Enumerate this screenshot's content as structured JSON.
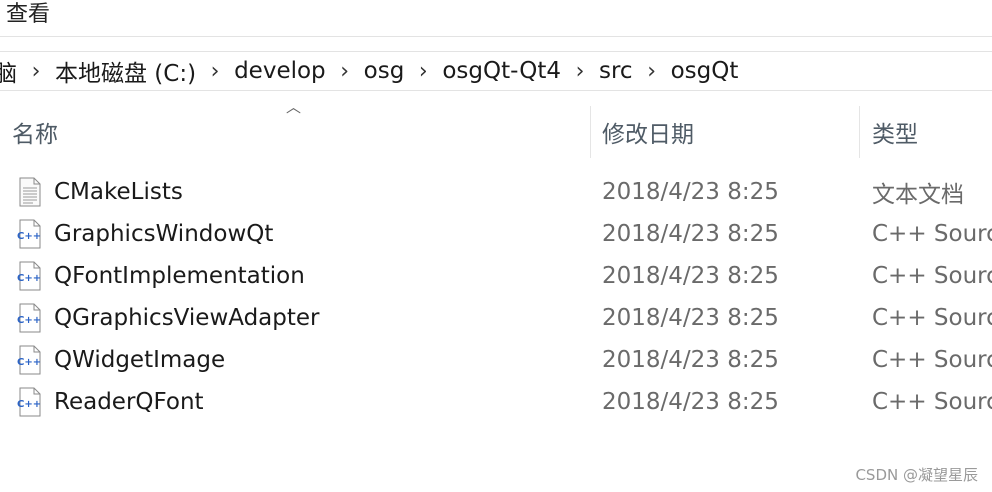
{
  "ribbon": {
    "view_tab": "查看"
  },
  "breadcrumb": [
    "脑",
    "本地磁盘 (C:)",
    "develop",
    "osg",
    "osgQt-Qt4",
    "src",
    "osgQt"
  ],
  "columns": {
    "name": "名称",
    "date": "修改日期",
    "type": "类型"
  },
  "files": [
    {
      "name": "CMakeLists",
      "date": "2018/4/23 8:25",
      "type": "文本文档",
      "icon": "text-file-icon"
    },
    {
      "name": "GraphicsWindowQt",
      "date": "2018/4/23 8:25",
      "type": "C++ Sourc",
      "icon": "cpp-file-icon"
    },
    {
      "name": "QFontImplementation",
      "date": "2018/4/23 8:25",
      "type": "C++ Sourc",
      "icon": "cpp-file-icon"
    },
    {
      "name": "QGraphicsViewAdapter",
      "date": "2018/4/23 8:25",
      "type": "C++ Sourc",
      "icon": "cpp-file-icon"
    },
    {
      "name": "QWidgetImage",
      "date": "2018/4/23 8:25",
      "type": "C++ Sourc",
      "icon": "cpp-file-icon"
    },
    {
      "name": "ReaderQFont",
      "date": "2018/4/23 8:25",
      "type": "C++ Sourc",
      "icon": "cpp-file-icon"
    }
  ],
  "watermark": "CSDN @凝望星辰"
}
